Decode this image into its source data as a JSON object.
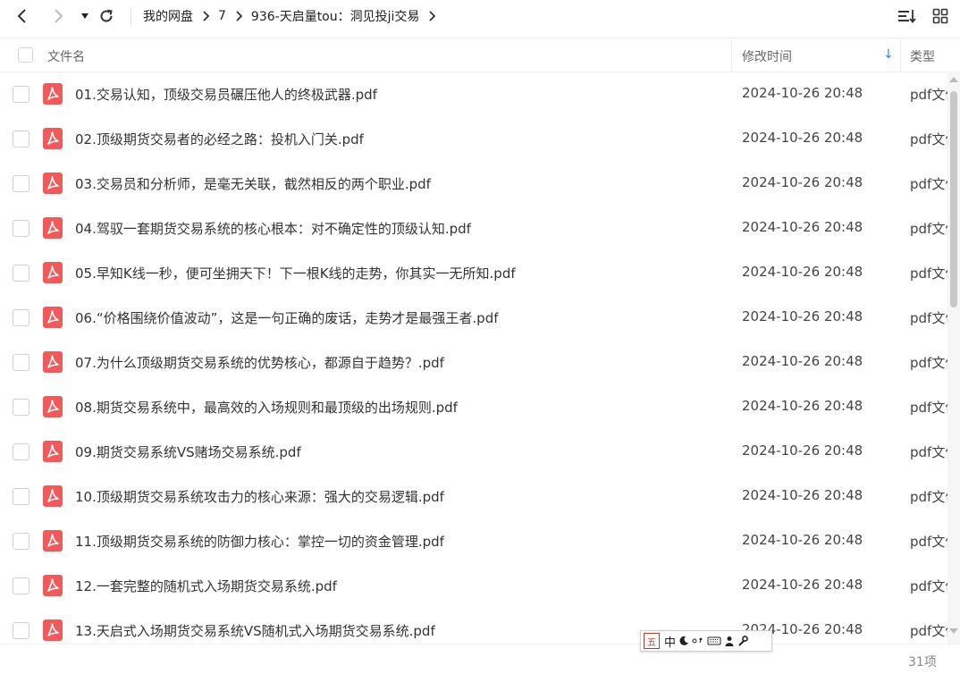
{
  "nav": {
    "back_icon": "chevron-left-icon",
    "forward_icon": "chevron-right-icon",
    "dropdown_icon": "caret-down-icon",
    "refresh_icon": "refresh-icon",
    "sort_icon": "sort-list-icon",
    "grid_icon": "grid-view-icon"
  },
  "breadcrumb": [
    "我的网盘",
    "7",
    "936-天启量tou：洞见投ji交易"
  ],
  "header": {
    "name": "文件名",
    "time": "修改时间",
    "sort_indicator": "↓",
    "type": "类型"
  },
  "files": [
    {
      "name": "01.交易认知，顶级交易员碾压他人的终极武器.pdf",
      "time": "2024-10-26 20:48",
      "type": "pdf文件"
    },
    {
      "name": "02.顶级期货交易者的必经之路：投机入门关.pdf",
      "time": "2024-10-26 20:48",
      "type": "pdf文件"
    },
    {
      "name": "03.交易员和分析师，是毫无关联，截然相反的两个职业.pdf",
      "time": "2024-10-26 20:48",
      "type": "pdf文件"
    },
    {
      "name": "04.驾驭一套期货交易系统的核心根本：对不确定性的顶级认知.pdf",
      "time": "2024-10-26 20:48",
      "type": "pdf文件"
    },
    {
      "name": "05.早知K线一秒，便可坐拥天下！下一根K线的走势，你其实一无所知.pdf",
      "time": "2024-10-26 20:48",
      "type": "pdf文件"
    },
    {
      "name": "06.“价格围绕价值波动”，这是一句正确的废话，走势才是最强王者.pdf",
      "time": "2024-10-26 20:48",
      "type": "pdf文件"
    },
    {
      "name": "07.为什么顶级期货交易系统的优势核心，都源自于趋势？.pdf",
      "time": "2024-10-26 20:48",
      "type": "pdf文件"
    },
    {
      "name": "08.期货交易系统中，最高效的入场规则和最顶级的出场规则.pdf",
      "time": "2024-10-26 20:48",
      "type": "pdf文件"
    },
    {
      "name": "09.期货交易系统VS赌场交易系统.pdf",
      "time": "2024-10-26 20:48",
      "type": "pdf文件"
    },
    {
      "name": "10.顶级期货交易系统攻击力的核心来源：强大的交易逻辑.pdf",
      "time": "2024-10-26 20:48",
      "type": "pdf文件"
    },
    {
      "name": "11.顶级期货交易系统的防御力核心：掌控一切的资金管理.pdf",
      "time": "2024-10-26 20:48",
      "type": "pdf文件"
    },
    {
      "name": "12.一套完整的随机式入场期货交易系统.pdf",
      "time": "2024-10-26 20:48",
      "type": "pdf文件"
    },
    {
      "name": "13.天启式入场期货交易系统VS随机式入场期货交易系统.pdf",
      "time": "2024-10-26 20:48",
      "type": "pdf文件"
    }
  ],
  "file_icon": "pdf-file-icon",
  "footer": {
    "count": "31项"
  },
  "ime": {
    "logo": "五",
    "mode": "中"
  },
  "colors": {
    "pdf_icon": "#f15a5a",
    "accent": "#1e90ff"
  }
}
